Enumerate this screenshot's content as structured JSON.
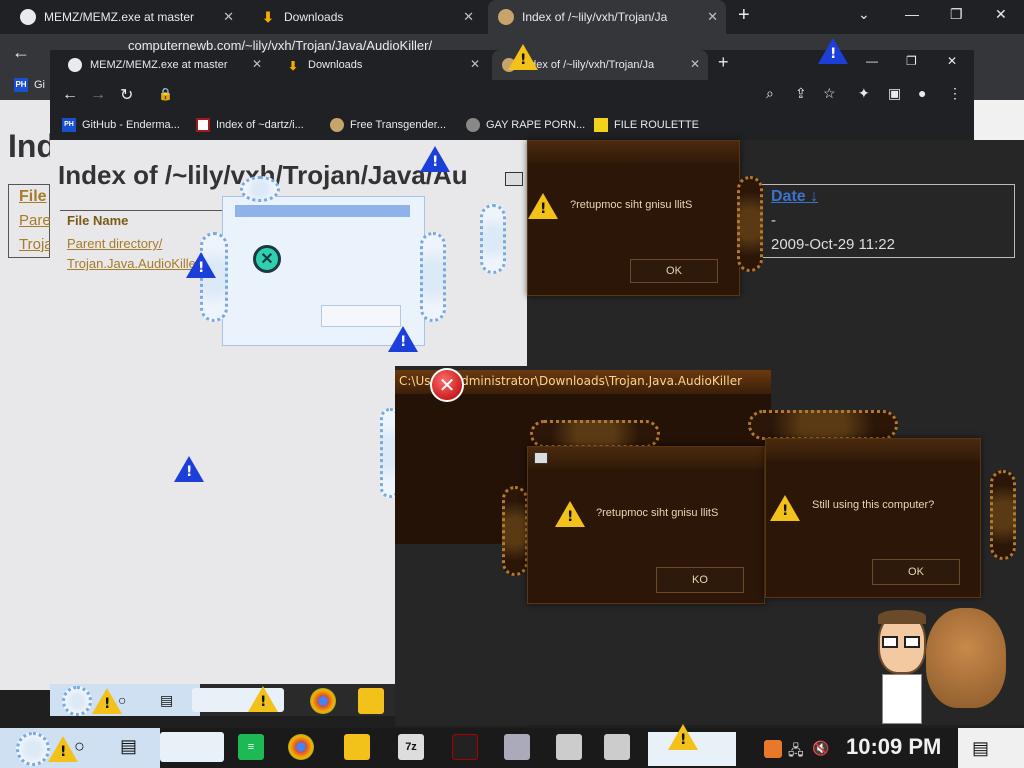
{
  "back_browser": {
    "tabs": [
      {
        "label": "MEMZ/MEMZ.exe at master",
        "icon": "github-icon"
      },
      {
        "label": "Downloads",
        "icon": "download-icon"
      },
      {
        "label": "Index of /~lily/vxh/Trojan/Ja",
        "icon": "hamster-icon"
      }
    ],
    "bookmark_fragment": "Gi",
    "page_title_fragment": "Ind",
    "table": {
      "header_fragment": "File",
      "rows": [
        "Pare",
        "Troja"
      ]
    }
  },
  "front_browser": {
    "tabs": [
      {
        "label": "MEMZ/MEMZ.exe at master",
        "icon": "github-icon"
      },
      {
        "label": "Downloads",
        "icon": "download-icon"
      },
      {
        "label": "ndex of /~lily/vxh/Trojan/Ja",
        "icon": "hamster-icon"
      }
    ],
    "url": "computernewb.com/~lily/vxh/Trojan/Java/AudioKiller/",
    "bookmarks": [
      {
        "label": "GitHub - Enderma...",
        "icon": "ph-icon"
      },
      {
        "label": "Index of ~dartz/i...",
        "icon": "index-icon"
      },
      {
        "label": "Free Transgender...",
        "icon": "hamster-icon"
      },
      {
        "label": "GAY RAPE PORN...",
        "icon": "globe-icon"
      },
      {
        "label": "FILE ROULETTE",
        "icon": "file-icon"
      }
    ]
  },
  "page": {
    "title": "Index of /~lily/vxh/Trojan/Java/Au",
    "column_file": "File Name",
    "rows": [
      "Parent directory/",
      "Trojan.Java.AudioKiller"
    ],
    "column_date": "Date",
    "sort_arrow": "↓",
    "dates": [
      "-",
      "2009-Oct-29 11:22"
    ]
  },
  "dialogs": {
    "top_right": {
      "message": "?retupmoc siht gnisu llitS",
      "button": "OK"
    },
    "path_title": "C:\\Users\\Administrator\\Downloads\\Trojan.Java.AudioKiller",
    "center": {
      "message": "?retupmoc siht gnisu llitS",
      "button": "KO"
    },
    "right": {
      "message": "Still using this computer?",
      "button": "OK"
    }
  },
  "taskbar": {
    "clock": "10:09 PM",
    "apps": [
      "spotify-icon",
      "chrome-icon",
      "folder-icon",
      "7zip-icon",
      "amd-icon",
      "photos-icon",
      "window-icon",
      "window-icon"
    ],
    "sevenzip_label": "7z"
  },
  "colors": {
    "chrome_dark": "#202124",
    "link": "#a57c29",
    "dialog_bg": "#2b1608",
    "warning": "#f2c21a",
    "blue_warning": "#1b3fd8"
  }
}
